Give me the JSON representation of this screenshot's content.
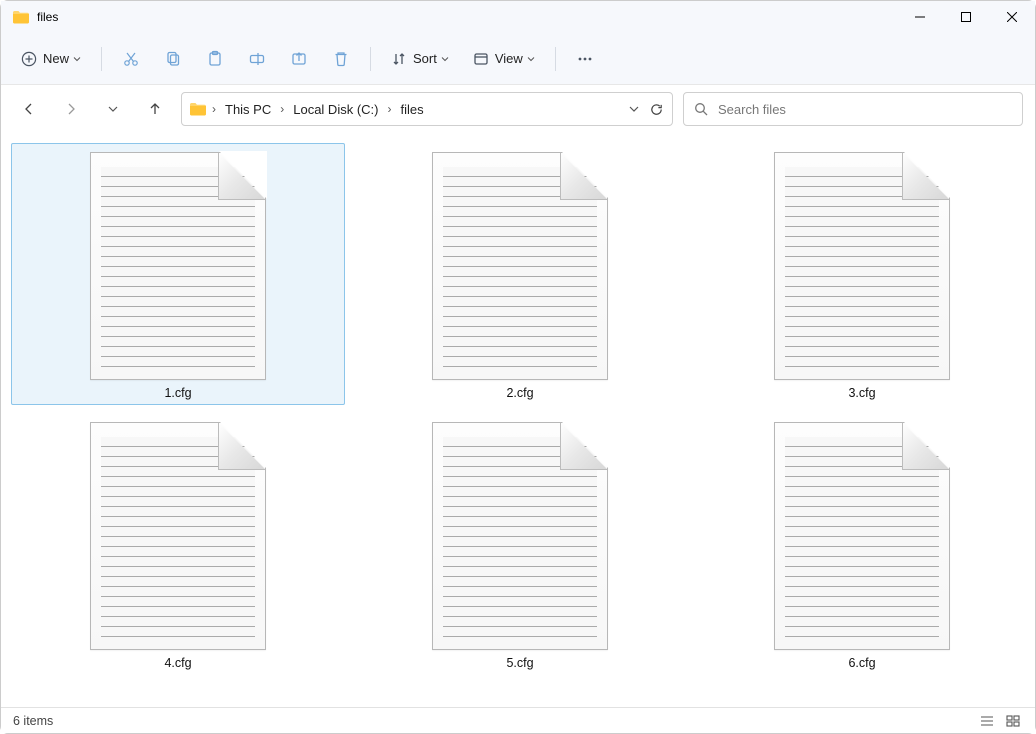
{
  "window": {
    "title": "files"
  },
  "toolbar": {
    "new_label": "New",
    "sort_label": "Sort",
    "view_label": "View"
  },
  "breadcrumbs": [
    "This PC",
    "Local Disk (C:)",
    "files"
  ],
  "search": {
    "placeholder": "Search files"
  },
  "files": [
    {
      "name": "1.cfg",
      "selected": true
    },
    {
      "name": "2.cfg",
      "selected": false
    },
    {
      "name": "3.cfg",
      "selected": false
    },
    {
      "name": "4.cfg",
      "selected": false
    },
    {
      "name": "5.cfg",
      "selected": false
    },
    {
      "name": "6.cfg",
      "selected": false
    }
  ],
  "status": {
    "text": "6 items"
  }
}
